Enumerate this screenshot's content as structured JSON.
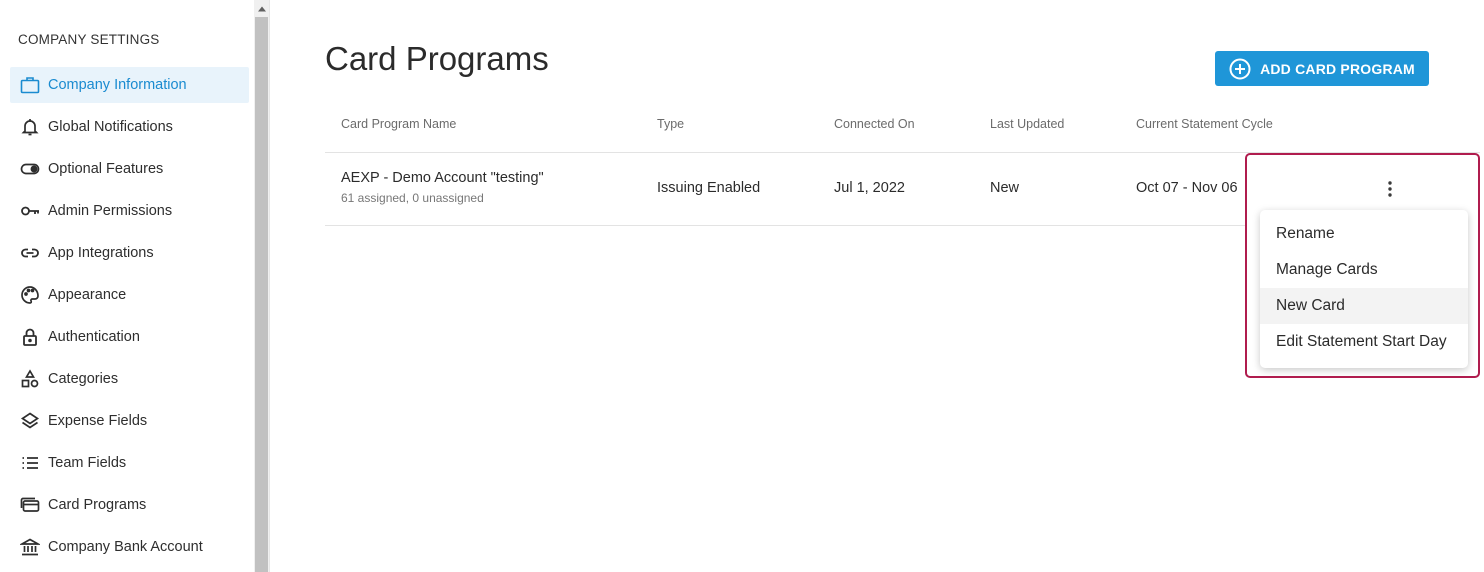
{
  "sidebar": {
    "heading": "COMPANY SETTINGS",
    "items": [
      {
        "label": "Company Information",
        "icon": "briefcase-icon",
        "active": true
      },
      {
        "label": "Global Notifications",
        "icon": "bell-icon"
      },
      {
        "label": "Optional Features",
        "icon": "toggle-icon"
      },
      {
        "label": "Admin Permissions",
        "icon": "key-icon"
      },
      {
        "label": "App Integrations",
        "icon": "link-icon"
      },
      {
        "label": "Appearance",
        "icon": "palette-icon"
      },
      {
        "label": "Authentication",
        "icon": "lock-icon"
      },
      {
        "label": "Categories",
        "icon": "shapes-icon"
      },
      {
        "label": "Expense Fields",
        "icon": "layers-icon"
      },
      {
        "label": "Team Fields",
        "icon": "list-icon"
      },
      {
        "label": "Card Programs",
        "icon": "cards-icon"
      },
      {
        "label": "Company Bank Account",
        "icon": "bank-icon"
      }
    ]
  },
  "main": {
    "title": "Card Programs",
    "add_button_label": "ADD CARD PROGRAM",
    "table": {
      "columns": [
        "Card Program Name",
        "Type",
        "Connected On",
        "Last Updated",
        "Current Statement Cycle"
      ],
      "rows": [
        {
          "name": "AEXP - Demo Account \"testing\"",
          "subtext": "61 assigned, 0 unassigned",
          "type": "Issuing Enabled",
          "connected_on": "Jul 1, 2022",
          "last_updated": "New",
          "statement_cycle": "Oct 07 - Nov 06"
        }
      ]
    },
    "row_menu": {
      "items": [
        "Rename",
        "Manage Cards",
        "New Card",
        "Edit Statement Start Day"
      ],
      "hovered": "New Card"
    }
  },
  "colors": {
    "accent": "#1f96d8",
    "active_nav_bg": "#e8f3fb",
    "highlight_border": "#b01c4e"
  }
}
